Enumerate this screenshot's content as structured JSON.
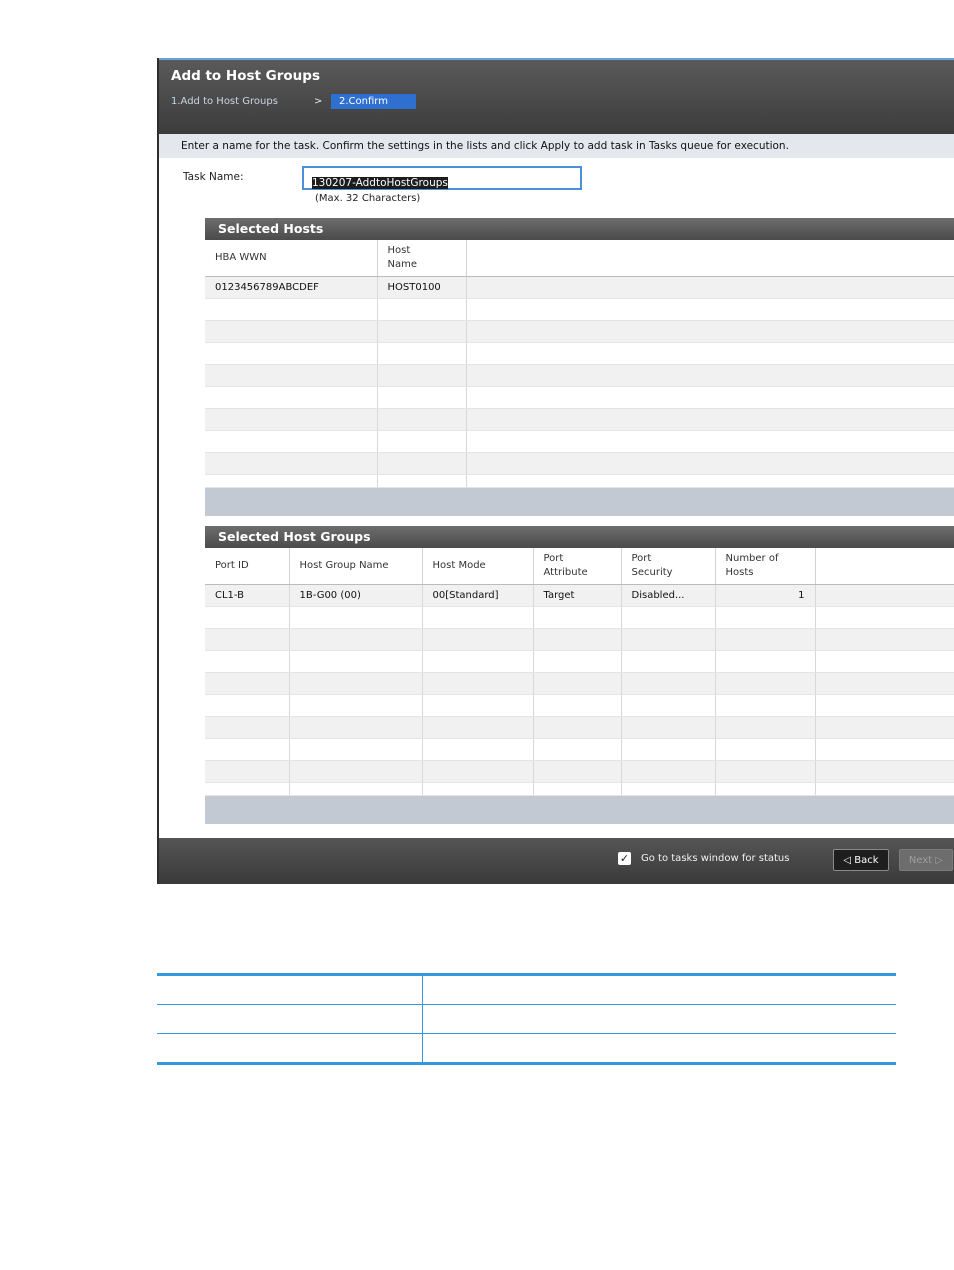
{
  "dialog": {
    "title": "Add to Host Groups",
    "steps": [
      "1.Add to Host Groups",
      ">",
      "2.Confirm"
    ],
    "instruction": "Enter a name for the task. Confirm the settings in the lists and click Apply to add task in Tasks queue for execution.",
    "task_name_label": "Task Name:",
    "task_name_value": "130207-AddtoHostGroups",
    "task_name_hint": "(Max. 32 Characters)"
  },
  "selected_hosts": {
    "title": "Selected Hosts",
    "columns": [
      "HBA WWN",
      "Host Name"
    ],
    "rows": [
      [
        "0123456789ABCDEF",
        "HOST0100"
      ]
    ]
  },
  "selected_host_groups": {
    "title": "Selected Host Groups",
    "columns": [
      "Port ID",
      "Host Group Name",
      "Host Mode",
      "Port Attribute",
      "Port Security",
      "Number of Hosts"
    ],
    "rows": [
      [
        "CL1-B",
        "1B-G00 (00)",
        "00[Standard]",
        "Target",
        "Disabled...",
        "1"
      ]
    ]
  },
  "footer": {
    "checkbox_checked": true,
    "checkbox_label": "Go to tasks window for status",
    "back_label": "◁ Back",
    "next_label": "Next ▷"
  },
  "colors": {
    "accent": "#2f6fd0",
    "table_rule": "#3399dd"
  }
}
